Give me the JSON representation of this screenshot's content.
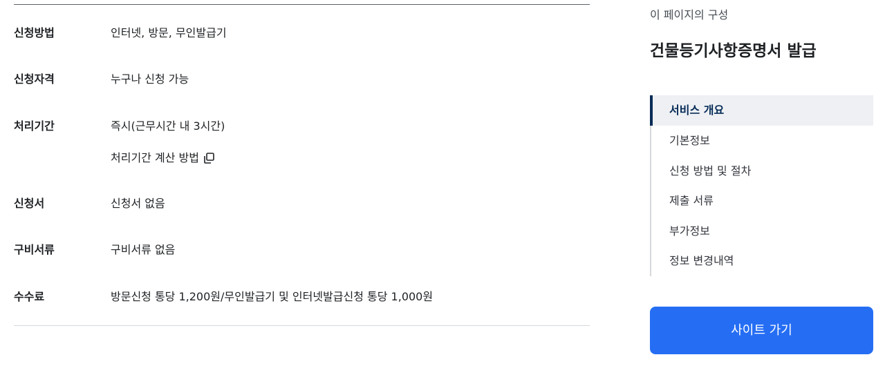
{
  "details": {
    "method": {
      "label": "신청방법",
      "value": "인터넷, 방문, 무인발급기"
    },
    "eligibility": {
      "label": "신청자격",
      "value": "누구나 신청 가능"
    },
    "processing": {
      "label": "처리기간",
      "value": "즉시(근무시간 내 3시간)",
      "calc_link": "처리기간 계산 방법",
      "calc_icon": "copy-icon"
    },
    "form": {
      "label": "신청서",
      "value": "신청서 없음"
    },
    "documents": {
      "label": "구비서류",
      "value": "구비서류 없음"
    },
    "fee": {
      "label": "수수료",
      "value": "방문신청 통당 1,200원/무인발급기 및 인터넷발급신청 통당 1,000원"
    }
  },
  "aside": {
    "caption": "이 페이지의 구성",
    "title": "건물등기사항증명서 발급",
    "toc": [
      {
        "label": "서비스 개요",
        "active": true
      },
      {
        "label": "기본정보",
        "active": false
      },
      {
        "label": "신청 방법 및 절차",
        "active": false
      },
      {
        "label": "제출 서류",
        "active": false
      },
      {
        "label": "부가정보",
        "active": false
      },
      {
        "label": "정보 변경내역",
        "active": false
      }
    ],
    "site_button": "사이트 가기"
  },
  "colors": {
    "accent": "#256ef4",
    "toc_active_text": "#052b57",
    "toc_active_bg": "#eef0f3"
  }
}
